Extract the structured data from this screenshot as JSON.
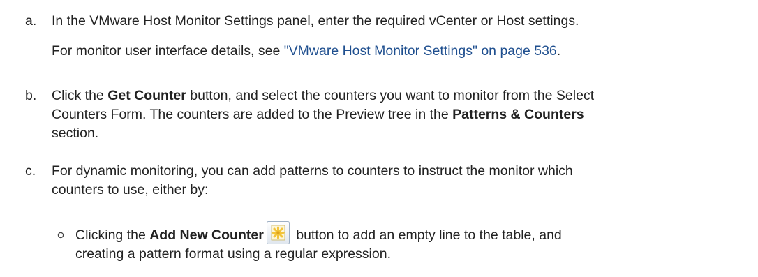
{
  "steps": [
    {
      "marker": "a.",
      "line1": "In the VMware Host Monitor Settings panel, enter the required vCenter or Host settings.",
      "note_prefix": "For monitor user interface details, see ",
      "note_link": "\"VMware Host Monitor Settings\" on page 536",
      "note_suffix": "."
    },
    {
      "marker": "b.",
      "l1_pre": "Click the ",
      "l1_bold": "Get Counter",
      "l1_post": " button, and select the counters you want to monitor from the Select",
      "l2_pre": "Counters Form. The counters are added to the Preview tree in the ",
      "l2_bold": "Patterns & Counters",
      "l3": "section."
    },
    {
      "marker": "c.",
      "line1": "For dynamic monitoring, you can add patterns to counters to instruct the monitor which",
      "line2": "counters to use, either by:"
    }
  ],
  "sub_bullet": {
    "pre": "Clicking the ",
    "bold": "Add New Counter",
    "post": " button to add an empty line to the table, and",
    "line2": "creating a pattern format using a regular expression.",
    "icon": "add-new-counter-icon"
  },
  "colors": {
    "text": "#222222",
    "link": "#1f4f8f",
    "icon_fill": "#f3c43a"
  }
}
